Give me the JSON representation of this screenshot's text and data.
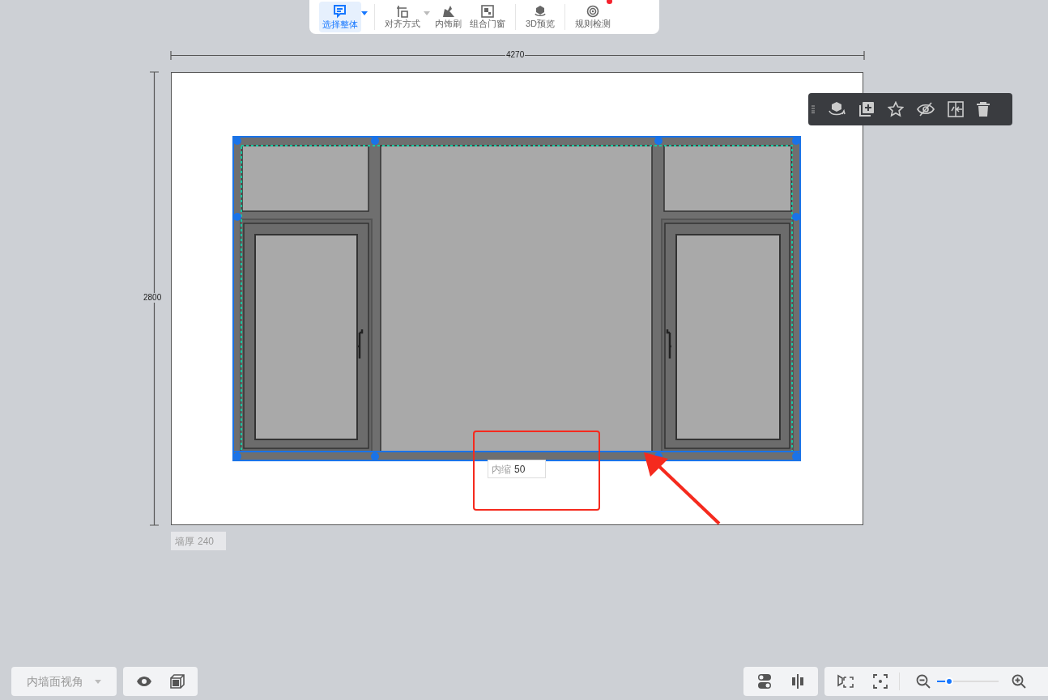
{
  "toolbar": {
    "items": [
      {
        "kind": "select",
        "label": "选择整体",
        "selected": true,
        "dropdown": true,
        "badge": false
      },
      {
        "kind": "align",
        "label": "对齐方式",
        "selected": false,
        "dropdown": true,
        "badge": false
      },
      {
        "kind": "brush",
        "label": "内饰刷",
        "selected": false,
        "dropdown": false,
        "badge": false
      },
      {
        "kind": "combine",
        "label": "组合门窗",
        "selected": false,
        "dropdown": false,
        "badge": false
      },
      {
        "kind": "preview3d",
        "label": "3D预览",
        "selected": false,
        "dropdown": false,
        "badge": false
      },
      {
        "kind": "rules",
        "label": "规则检测",
        "selected": false,
        "dropdown": false,
        "badge": true
      }
    ]
  },
  "canvas": {
    "width_dimension": "4270",
    "height_dimension": "2800",
    "inset": {
      "label": "内缩",
      "value": "50"
    },
    "wall_thickness": {
      "label": "墙厚",
      "value": "240"
    }
  },
  "bottom_left": {
    "view_select": "内墙面视角"
  },
  "zoom": {
    "level": 0.2
  }
}
